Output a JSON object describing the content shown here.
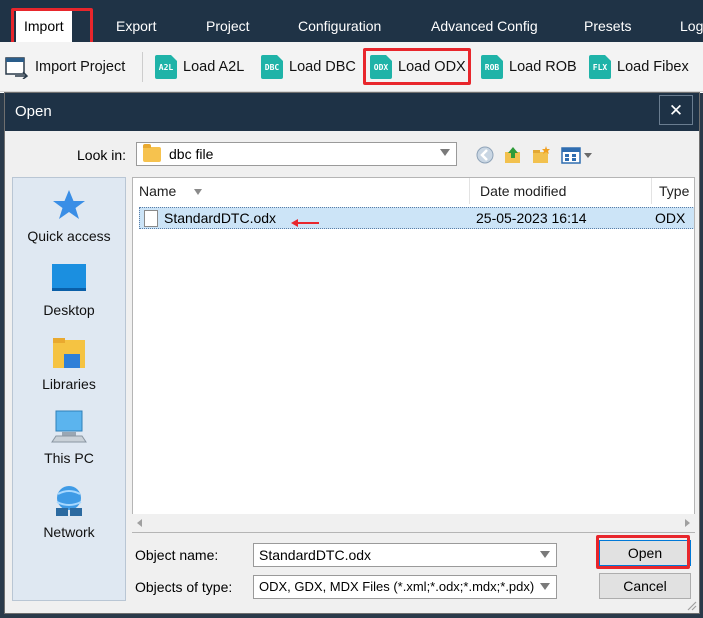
{
  "menu": {
    "items": [
      {
        "label": "Import"
      },
      {
        "label": "Export"
      },
      {
        "label": "Project"
      },
      {
        "label": "Configuration"
      },
      {
        "label": "Advanced Config"
      },
      {
        "label": "Presets"
      },
      {
        "label": "Log"
      }
    ]
  },
  "ribbon": {
    "import_project": "Import Project",
    "buttons": [
      {
        "icon_text": "A2L",
        "label": "Load A2L"
      },
      {
        "icon_text": "DBC",
        "label": "Load DBC"
      },
      {
        "icon_text": "ODX",
        "label": "Load ODX"
      },
      {
        "icon_text": "ROB",
        "label": "Load ROB"
      },
      {
        "icon_text": "FLX",
        "label": "Load Fibex"
      }
    ]
  },
  "dialog": {
    "title": "Open",
    "close_glyph": "✕",
    "look_in_label": "Look in:",
    "look_in_value": "dbc file",
    "places": [
      {
        "label": "Quick access",
        "icon": "star-icon"
      },
      {
        "label": "Desktop",
        "icon": "desktop-icon"
      },
      {
        "label": "Libraries",
        "icon": "libraries-icon"
      },
      {
        "label": "This PC",
        "icon": "pc-icon"
      },
      {
        "label": "Network",
        "icon": "network-icon"
      }
    ],
    "columns": {
      "name": "Name",
      "date": "Date modified",
      "type": "Type"
    },
    "files": [
      {
        "name": "StandardDTC.odx",
        "date": "25-05-2023 16:14",
        "type": "ODX"
      }
    ],
    "object_name_label": "Object name:",
    "object_name_value": "StandardDTC.odx",
    "object_type_label": "Objects of type:",
    "object_type_value": "ODX, GDX, MDX Files (*.xml;*.odx;*.mdx;*.pdx)",
    "open_button": "Open",
    "cancel_button": "Cancel"
  },
  "colors": {
    "menubar": "#1f3346",
    "highlight": "#e8262c",
    "ribbon_icon": "#1fb3a8",
    "selection": "#cce4f7"
  }
}
